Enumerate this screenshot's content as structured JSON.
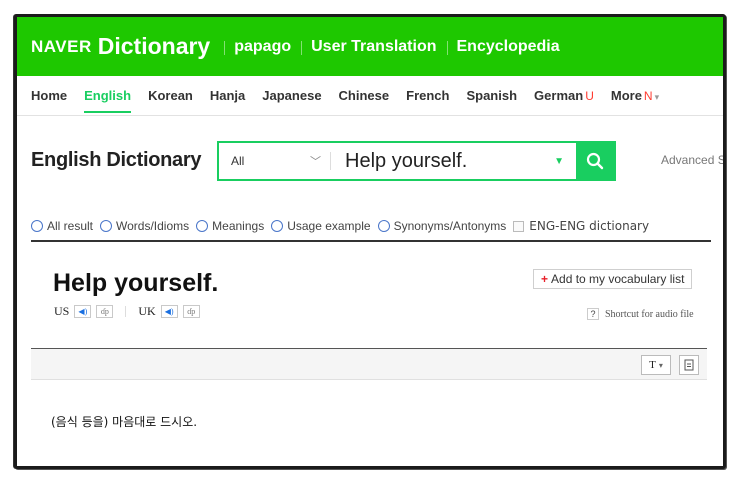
{
  "header": {
    "brand": "NAVER",
    "title": "Dictionary",
    "links": [
      "papago",
      "User Translation",
      "Encyclopedia"
    ]
  },
  "nav": {
    "items": [
      {
        "label": "Home"
      },
      {
        "label": "English",
        "active": true
      },
      {
        "label": "Korean"
      },
      {
        "label": "Hanja"
      },
      {
        "label": "Japanese"
      },
      {
        "label": "Chinese"
      },
      {
        "label": "French"
      },
      {
        "label": "Spanish"
      },
      {
        "label": "German",
        "mark": "U"
      },
      {
        "label": "More",
        "mark": "N"
      }
    ]
  },
  "search": {
    "section_title": "English Dictionary",
    "category": "All",
    "query": "Help yourself.",
    "advanced": "Advanced S"
  },
  "filters": [
    "All result",
    "Words/Idioms",
    "Meanings",
    "Usage example",
    "Synonyms/Antonyms"
  ],
  "eng_eng": "ENG-ENG dictionary",
  "entry": {
    "word": "Help yourself.",
    "us_label": "US",
    "uk_label": "UK",
    "add_vocab": "Add to my vocabulary list",
    "shortcut_q": "?",
    "shortcut_label": "Shortcut for audio file",
    "toolbar_t": "T",
    "meaning": "(음식 등을) 마음대로 드시오."
  },
  "colors": {
    "brand_green": "#1ec800",
    "accent_green": "#19ce60"
  }
}
